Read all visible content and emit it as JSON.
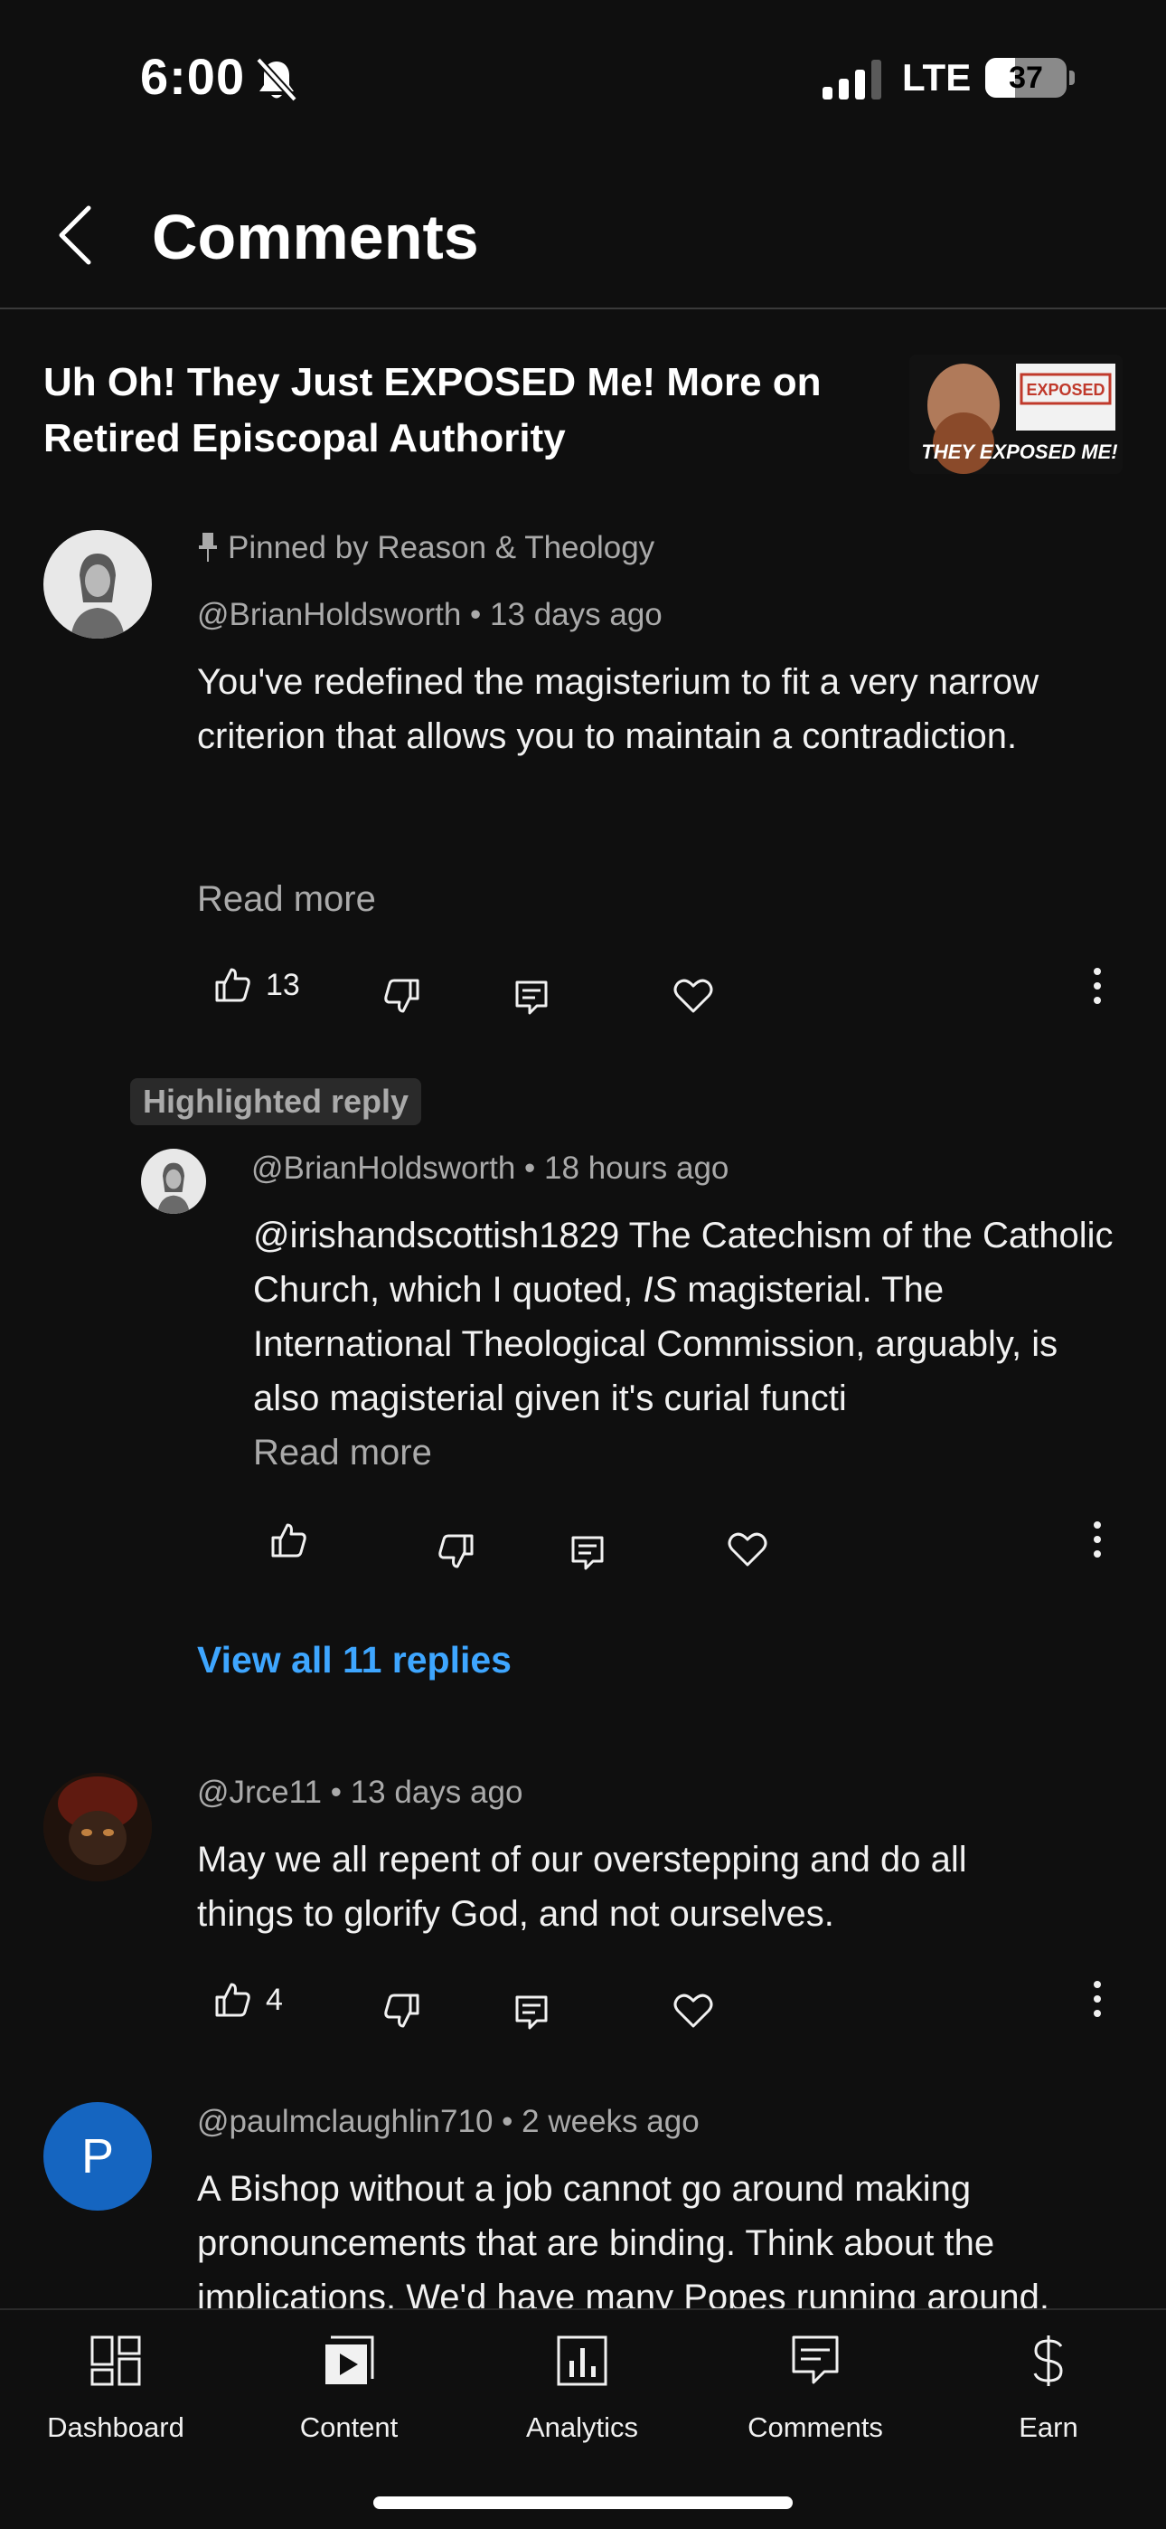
{
  "status_bar": {
    "time": "6:00",
    "network": "LTE",
    "battery": "37",
    "battery_level": 0.37
  },
  "header": {
    "title": "Comments"
  },
  "video": {
    "title": "Uh Oh! They Just EXPOSED Me! More on Retired Episcopal Authority",
    "thumb_stamp": "EXPOSED",
    "thumb_caption": "THEY EXPOSED ME!"
  },
  "comments": [
    {
      "pinned_label": "Pinned by Reason & Theology",
      "author": "@BrianHoldsworth",
      "time": "13 days ago",
      "text": "You've redefined the magisterium to fit a very narrow criterion that allows you to maintain a contradiction.",
      "read_more": "Read more",
      "likes": "13"
    },
    {
      "author": "@Jrce11",
      "time": "13 days ago",
      "text": "May we all repent of our overstepping and do all things to glorify God, and not ourselves.",
      "likes": "4"
    },
    {
      "avatar_letter": "P",
      "author": "@paulmclaughlin710",
      "time": "2 weeks ago",
      "text": "A Bishop without a job cannot go around making pronouncements that are binding. Think about the implications. We'd have many Popes running around."
    }
  ],
  "highlighted_reply": {
    "chip": "Highlighted reply",
    "author": "@BrianHoldsworth",
    "time": "18 hours ago",
    "text_mention": "@irishandscottish1829",
    "text_part1": "  The Catechism of the Catholic Church, which I quoted, ",
    "text_emph": "IS",
    "text_part2": " magisterial. The International Theological Commission, arguably, is also magisterial given it's curial functi",
    "read_more": "Read more"
  },
  "view_replies": "View all 11 replies",
  "separator": "•",
  "nav": [
    {
      "label": "Dashboard",
      "icon": "dashboard-icon"
    },
    {
      "label": "Content",
      "icon": "content-icon"
    },
    {
      "label": "Analytics",
      "icon": "analytics-icon"
    },
    {
      "label": "Comments",
      "icon": "comments-icon"
    },
    {
      "label": "Earn",
      "icon": "dollar-icon"
    }
  ],
  "colors": {
    "background": "#0f0f0f",
    "link": "#3ea6ff",
    "muted": "#aaaaaa",
    "avatar_p": "#1565c0"
  }
}
